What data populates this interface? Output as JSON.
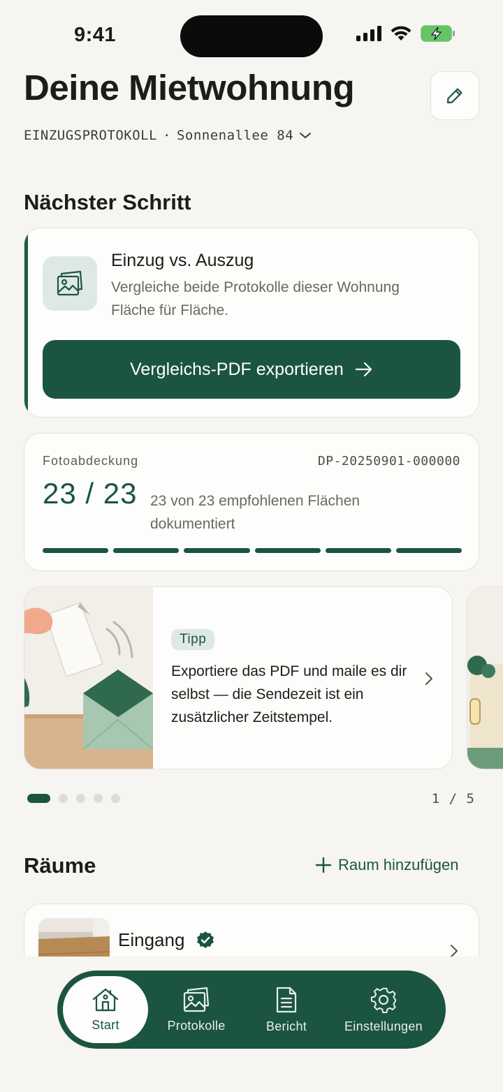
{
  "status_bar": {
    "time": "9:41"
  },
  "header": {
    "title": "Deine Mietwohnung",
    "protocol_type": "EINZUGSPROTOKOLL",
    "separator": "·",
    "address": "Sonnenallee 84"
  },
  "next_step": {
    "section_title": "Nächster Schritt",
    "title": "Einzug vs. Auszug",
    "description": "Vergleiche beide Protokolle dieser Wohnung Fläche für Fläche.",
    "button_label": "Vergleichs-PDF exportieren"
  },
  "coverage": {
    "label": "Fotoabdeckung",
    "document_id": "DP-20250901-000000",
    "count": "23 / 23",
    "description": "23 von 23 empfohlenen Flächen dokumentiert",
    "segments_total": 6,
    "segments_filled": 6
  },
  "tip": {
    "badge": "Tipp",
    "text": "Exportiere das PDF und maile es dir selbst — die Sendezeit ist ein zusätzlicher Zeitstempel.",
    "page_counter": "1 / 5",
    "total_pages": 5,
    "current_page": 1
  },
  "rooms": {
    "section_title": "Räume",
    "add_label": "Raum hinzufügen",
    "items": [
      {
        "name": "Eingang",
        "verified": true
      }
    ]
  },
  "tabbar": {
    "tabs": [
      {
        "label": "Start",
        "icon": "house-icon",
        "active": true
      },
      {
        "label": "Protokolle",
        "icon": "photos-icon",
        "active": false
      },
      {
        "label": "Bericht",
        "icon": "document-icon",
        "active": false
      },
      {
        "label": "Einstellungen",
        "icon": "gear-icon",
        "active": false
      }
    ]
  },
  "colors": {
    "accent": "#1b5541",
    "accent_light": "#dfe9e3",
    "background": "#f6f5f1",
    "card": "#fdfdfb"
  }
}
